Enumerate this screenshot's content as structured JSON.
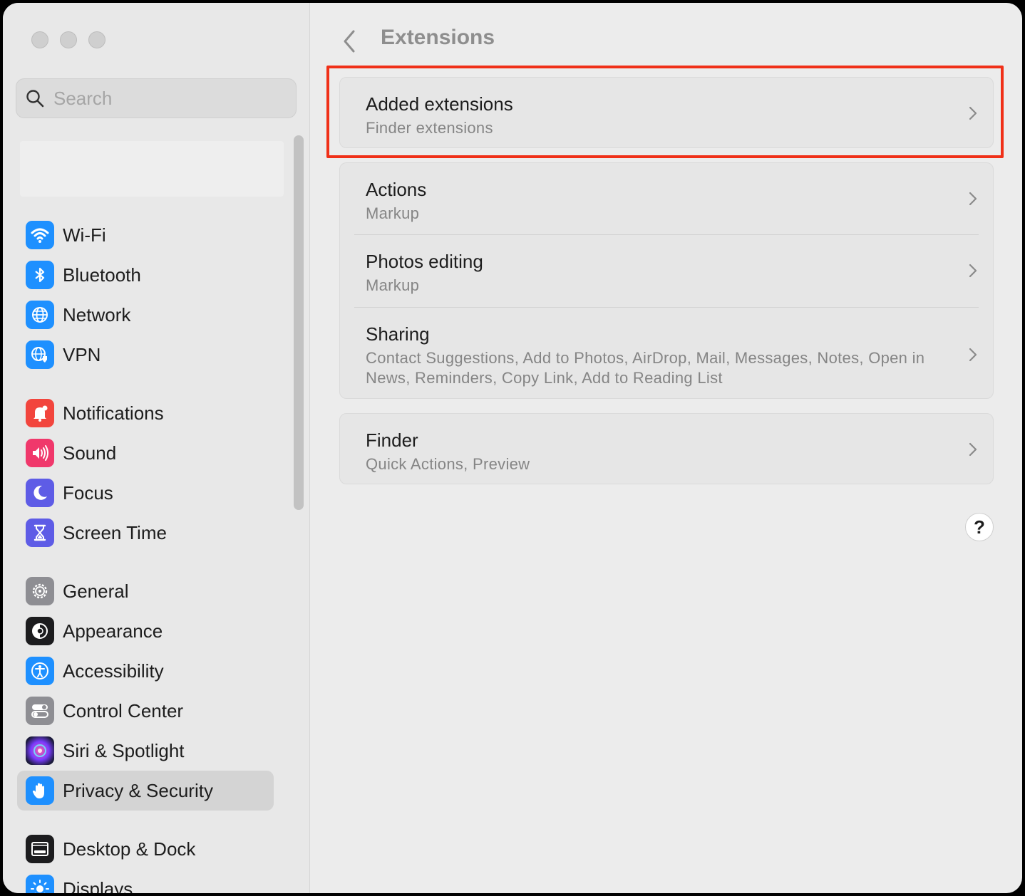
{
  "window": {
    "title": "Extensions"
  },
  "search": {
    "placeholder": "Search"
  },
  "sidebar": {
    "items": [
      {
        "label": "Wi-Fi",
        "icon": "wifi-icon",
        "color": "#1e90ff"
      },
      {
        "label": "Bluetooth",
        "icon": "bluetooth-icon",
        "color": "#1e90ff"
      },
      {
        "label": "Network",
        "icon": "globe-icon",
        "color": "#1e90ff"
      },
      {
        "label": "VPN",
        "icon": "vpn-globe-icon",
        "color": "#1e90ff"
      },
      {
        "label": "Notifications",
        "icon": "bell-icon",
        "color": "#f2453d"
      },
      {
        "label": "Sound",
        "icon": "speaker-icon",
        "color": "#f0386b"
      },
      {
        "label": "Focus",
        "icon": "moon-icon",
        "color": "#5e5ce6"
      },
      {
        "label": "Screen Time",
        "icon": "hourglass-icon",
        "color": "#5e5ce6"
      },
      {
        "label": "General",
        "icon": "gear-icon",
        "color": "#8e8e93"
      },
      {
        "label": "Appearance",
        "icon": "appearance-icon",
        "color": "#1c1c1e"
      },
      {
        "label": "Accessibility",
        "icon": "accessibility-icon",
        "color": "#1e90ff"
      },
      {
        "label": "Control Center",
        "icon": "toggles-icon",
        "color": "#8e8e93"
      },
      {
        "label": "Siri & Spotlight",
        "icon": "siri-icon",
        "color": "#3a1e6e"
      },
      {
        "label": "Privacy & Security",
        "icon": "hand-icon",
        "color": "#1e90ff",
        "selected": true
      },
      {
        "label": "Desktop & Dock",
        "icon": "dock-icon",
        "color": "#1c1c1e"
      },
      {
        "label": "Displays",
        "icon": "sun-icon",
        "color": "#1e90ff"
      }
    ]
  },
  "main": {
    "cards": [
      {
        "rows": [
          {
            "title": "Added extensions",
            "subtitle": "Finder extensions"
          }
        ]
      },
      {
        "rows": [
          {
            "title": "Actions",
            "subtitle": "Markup"
          },
          {
            "title": "Photos editing",
            "subtitle": "Markup"
          },
          {
            "title": "Sharing",
            "subtitle": "Contact Suggestions, Add to Photos, AirDrop, Mail, Messages, Notes, Open in News, Reminders, Copy Link, Add to Reading List"
          }
        ]
      },
      {
        "rows": [
          {
            "title": "Finder",
            "subtitle": "Quick Actions, Preview"
          }
        ]
      }
    ],
    "help_label": "?"
  },
  "annotation": {
    "highlight_color": "#f03018"
  }
}
